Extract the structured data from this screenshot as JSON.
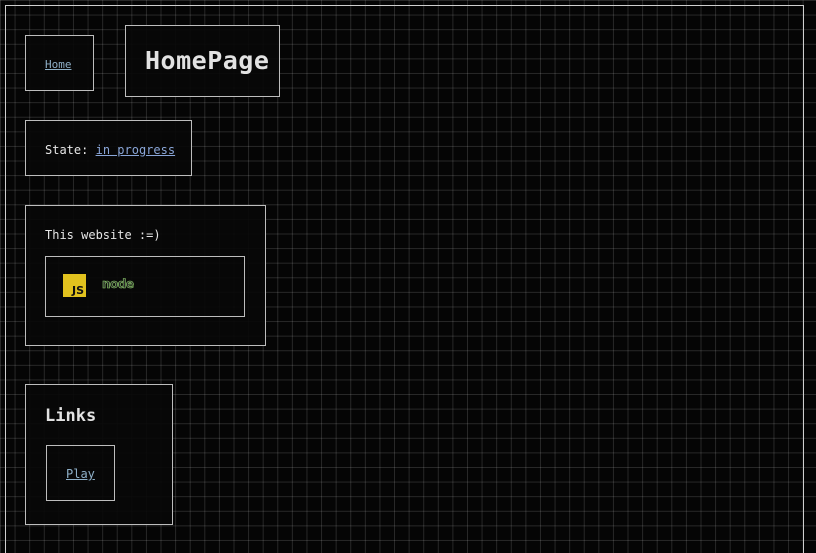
{
  "nav": {
    "home_label": "Home"
  },
  "header": {
    "title": "HomePage"
  },
  "status": {
    "label": "State:",
    "value": "in progress"
  },
  "about": {
    "text": "This website :=)",
    "tech": [
      {
        "icon": "javascript-logo-icon",
        "text": "JS"
      },
      {
        "icon": "nodejs-logo-icon",
        "text": "node"
      }
    ]
  },
  "links": {
    "heading": "Links",
    "items": [
      {
        "label": "Play"
      }
    ]
  },
  "colors": {
    "background": "#050505",
    "link": "#8aa6d8",
    "js_yellow": "#e2c21e",
    "node_green": "#8fd16c"
  }
}
